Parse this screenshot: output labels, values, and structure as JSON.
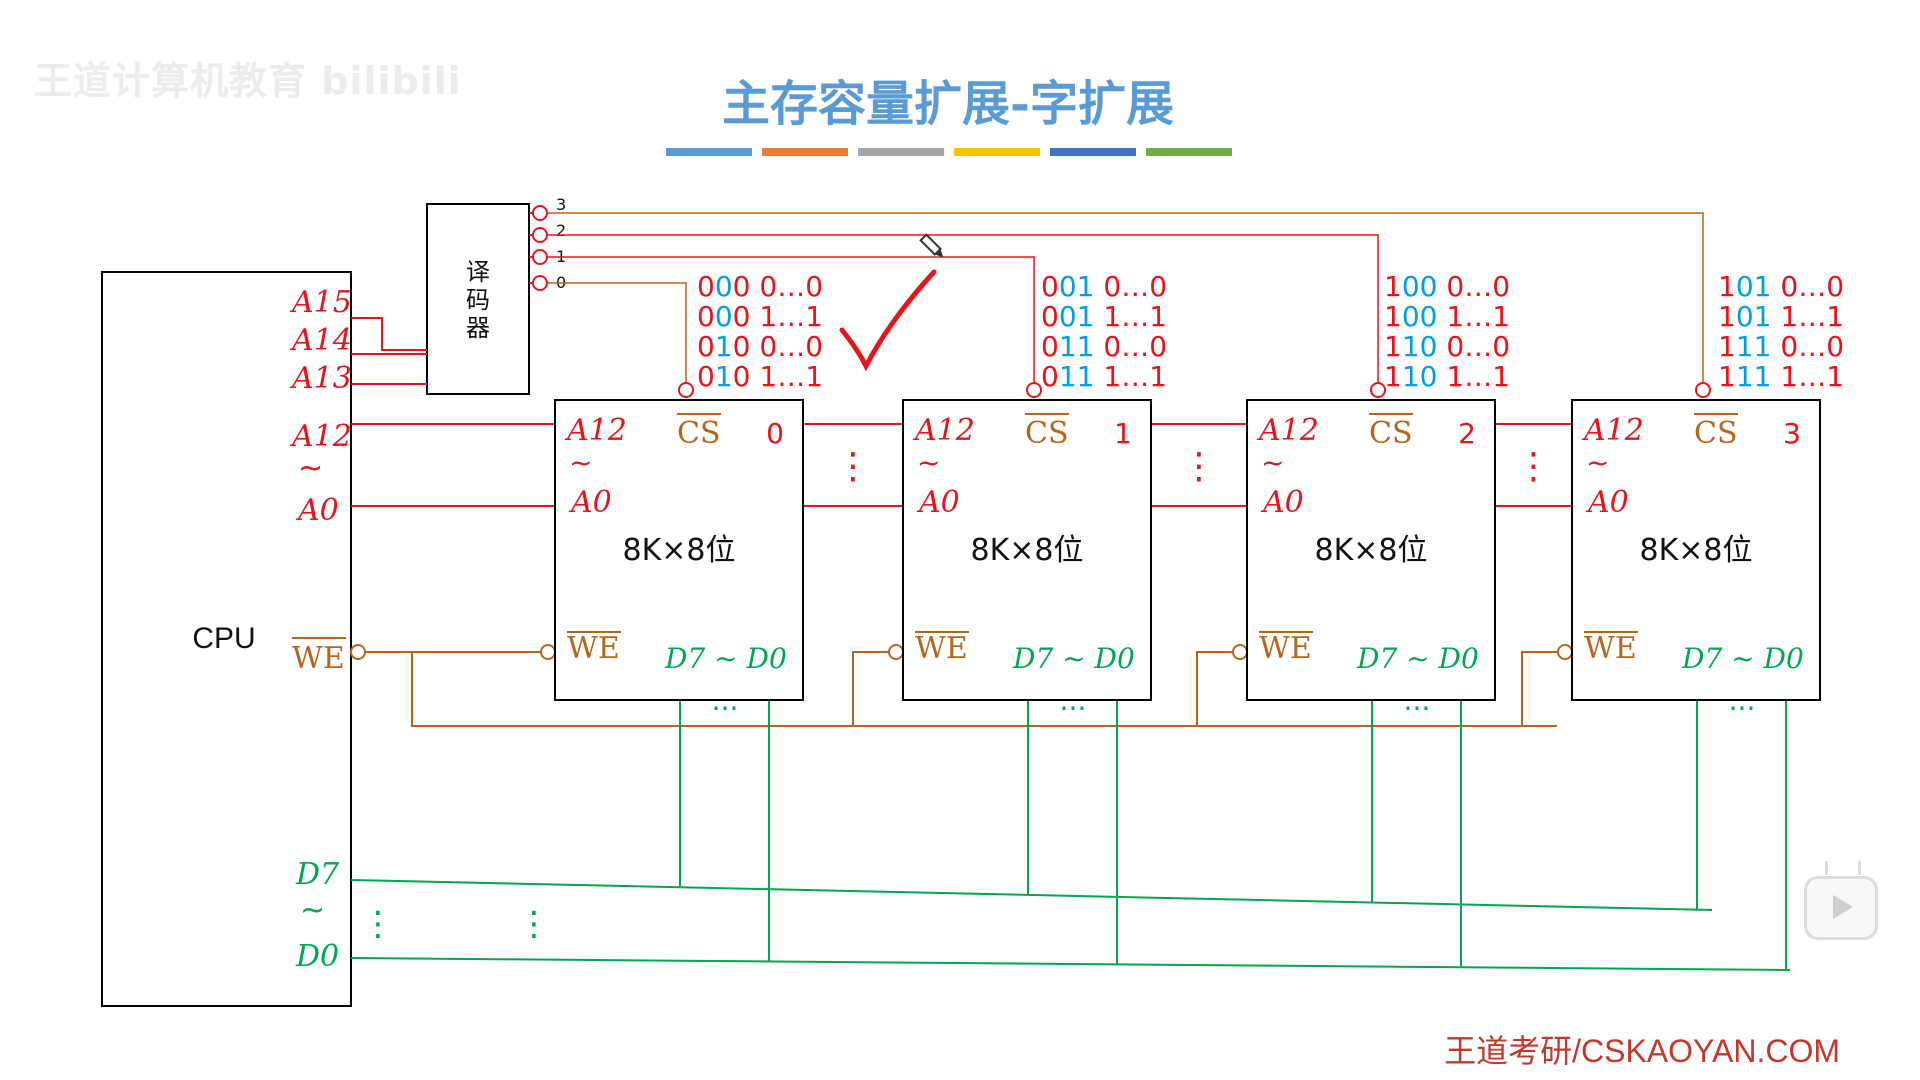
{
  "watermark": "王道计算机教育 bilibili",
  "title": "主存容量扩展-字扩展",
  "title_bar_colors": [
    "#5b9bd5",
    "#ed7d31",
    "#a5a5a5",
    "#ffc000",
    "#4472c4",
    "#70ad47"
  ],
  "cpu": {
    "label": "CPU",
    "addr_high": [
      "A15",
      "A14",
      "A13"
    ],
    "addr_low_top": "A12",
    "addr_low_bottom": "A0",
    "range_sep": "~",
    "we": "WE",
    "data_top": "D7",
    "data_bottom": "D0"
  },
  "decoder": {
    "label": [
      "译",
      "码",
      "器"
    ],
    "outputs": [
      "3",
      "2",
      "1",
      "0"
    ]
  },
  "chips": [
    {
      "index": "0",
      "a_top": "A12",
      "a_bottom": "A0",
      "cs": "CS",
      "capacity": "8K×8位",
      "we": "WE",
      "data": "D7 ~ D0",
      "addresses": [
        [
          "000",
          " 0…0"
        ],
        [
          "000",
          " 1…1"
        ],
        [
          "010",
          " 0…0"
        ],
        [
          "010",
          " 1…1"
        ]
      ]
    },
    {
      "index": "1",
      "a_top": "A12",
      "a_bottom": "A0",
      "cs": "CS",
      "capacity": "8K×8位",
      "we": "WE",
      "data": "D7 ~ D0",
      "addresses": [
        [
          "001",
          " 0…0"
        ],
        [
          "001",
          " 1…1"
        ],
        [
          "011",
          " 0…0"
        ],
        [
          "011",
          " 1…1"
        ]
      ]
    },
    {
      "index": "2",
      "a_top": "A12",
      "a_bottom": "A0",
      "cs": "CS",
      "capacity": "8K×8位",
      "we": "WE",
      "data": "D7 ~ D0",
      "addresses": [
        [
          "100",
          " 0…0"
        ],
        [
          "100",
          " 1…1"
        ],
        [
          "110",
          " 0…0"
        ],
        [
          "110",
          " 1…1"
        ]
      ]
    },
    {
      "index": "3",
      "a_top": "A12",
      "a_bottom": "A0",
      "cs": "CS",
      "capacity": "8K×8位",
      "we": "WE",
      "data": "D7 ~ D0",
      "addresses": [
        [
          "101",
          " 0…0"
        ],
        [
          "101",
          " 1…1"
        ],
        [
          "111",
          " 0…0"
        ],
        [
          "111",
          " 1…1"
        ]
      ]
    }
  ],
  "colors": {
    "address": "#e8141c",
    "control": "#b5651d",
    "data": "#00a651",
    "annotation_blue": "#00a0e0",
    "title": "#5b9bd5"
  },
  "footer": "王道考研/CSKAOYAN.COM",
  "icons": [
    "pen-cursor-icon",
    "checkmark-icon",
    "play-icon"
  ]
}
